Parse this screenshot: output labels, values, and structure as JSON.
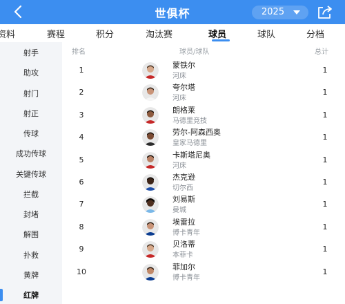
{
  "header": {
    "title": "世俱杯",
    "year": "2025",
    "icons": {
      "back": "back-arrow-icon",
      "share": "share-icon",
      "year_caret": "caret-down-icon"
    },
    "colors": {
      "bar": "#3c8ef0",
      "accent": "#3c8ef0"
    }
  },
  "tabs": [
    {
      "label": "资料"
    },
    {
      "label": "赛程"
    },
    {
      "label": "积分"
    },
    {
      "label": "淘汰赛"
    },
    {
      "label": "球员"
    },
    {
      "label": "球队"
    },
    {
      "label": "分档"
    }
  ],
  "active_tab": "球员",
  "sidebar": {
    "items": [
      {
        "label": "射手"
      },
      {
        "label": "助攻"
      },
      {
        "label": "射门"
      },
      {
        "label": "射正"
      },
      {
        "label": "传球"
      },
      {
        "label": "成功传球"
      },
      {
        "label": "关键传球"
      },
      {
        "label": "拦截"
      },
      {
        "label": "封堵"
      },
      {
        "label": "解围"
      },
      {
        "label": "扑救"
      },
      {
        "label": "黄牌"
      },
      {
        "label": "红牌"
      }
    ],
    "active": "红牌"
  },
  "table": {
    "headers": {
      "rank": "排名",
      "player": "球员/球队",
      "total": "总计"
    },
    "rows": [
      {
        "rank": "1",
        "name": "蒙铁尔",
        "team": "河床",
        "total": "1"
      },
      {
        "rank": "2",
        "name": "夸尔塔",
        "team": "河床",
        "total": "1"
      },
      {
        "rank": "3",
        "name": "朗格莱",
        "team": "马德里竞技",
        "total": "1"
      },
      {
        "rank": "4",
        "name": "劳尔-阿森西奥",
        "team": "皇家马德里",
        "total": "1"
      },
      {
        "rank": "5",
        "name": "卡斯塔尼奥",
        "team": "河床",
        "total": "1"
      },
      {
        "rank": "6",
        "name": "杰克逊",
        "team": "切尔西",
        "total": "1"
      },
      {
        "rank": "7",
        "name": "刘易斯",
        "team": "曼城",
        "total": "1"
      },
      {
        "rank": "8",
        "name": "埃雷拉",
        "team": "博卡青年",
        "total": "1"
      },
      {
        "rank": "9",
        "name": "贝洛蒂",
        "team": "本菲卡",
        "total": "1"
      },
      {
        "rank": "10",
        "name": "菲加尔",
        "team": "博卡青年",
        "total": "1"
      }
    ]
  }
}
